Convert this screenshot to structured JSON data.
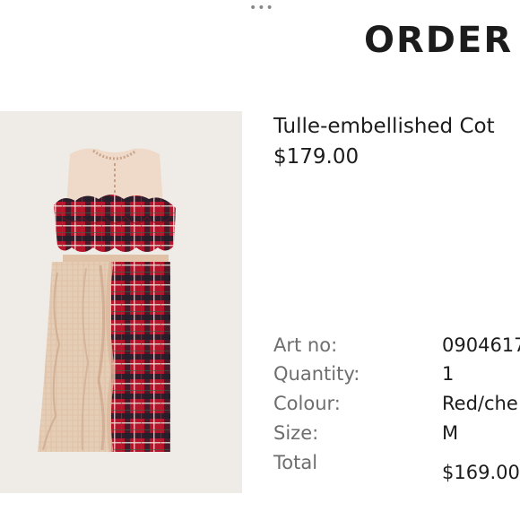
{
  "header": {
    "more_icon": "more-horizontal-icon",
    "title": "ORDER"
  },
  "product": {
    "image_description_icon": "product-photo",
    "name": "Tulle-embellished Cot",
    "price": "$179.00"
  },
  "details": {
    "art_no_label": "Art no:",
    "art_no_value": "0904617",
    "quantity_label": "Quantity:",
    "quantity_value": "1",
    "colour_label": "Colour:",
    "colour_value": "Red/che",
    "size_label": "Size:",
    "size_value": "M",
    "total_label": "Total",
    "total_value": "$169.00"
  },
  "colors": {
    "background": "#ffffff",
    "image_background": "#efece8",
    "label_gray": "#6e6e6e",
    "text_dark": "#1c1c1c",
    "plaid_red": "#b5142a",
    "tulle_nude": "#e8cdb7"
  }
}
